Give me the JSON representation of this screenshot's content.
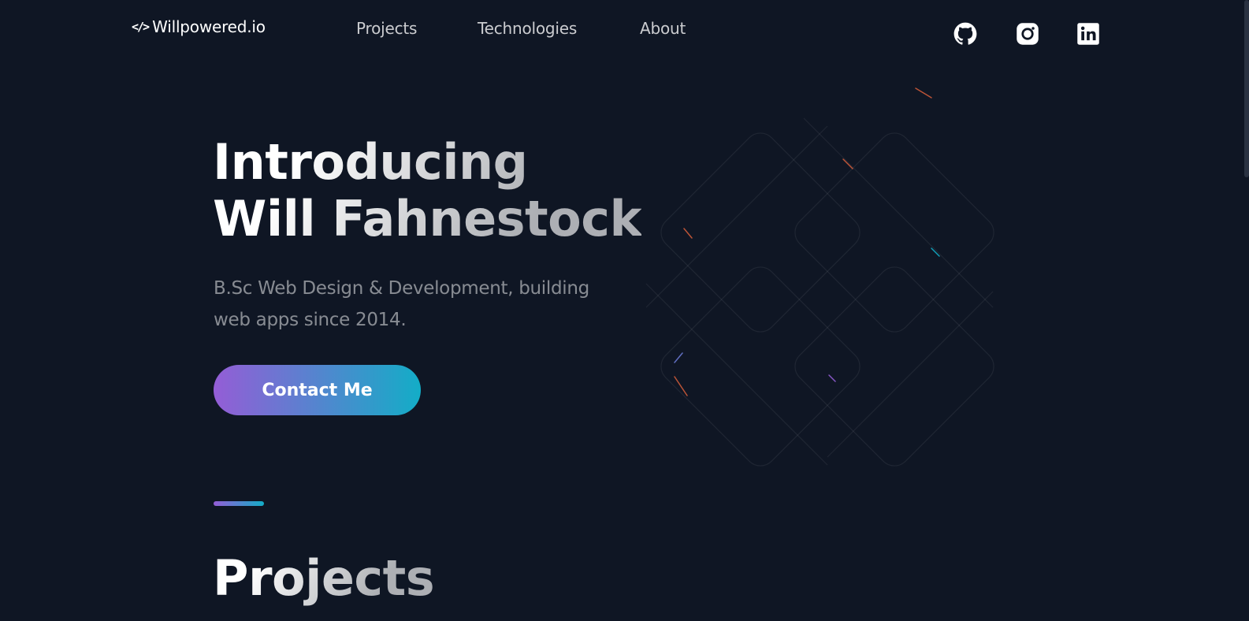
{
  "header": {
    "logo_icon": "</>",
    "logo_text": "Willpowered.io",
    "nav": [
      {
        "label": "Projects"
      },
      {
        "label": "Technologies"
      },
      {
        "label": "About"
      }
    ],
    "social_icons": [
      "github-icon",
      "instagram-icon",
      "linkedin-icon"
    ]
  },
  "hero": {
    "title_line1": "Introducing",
    "title_line2": "Will Fahnestock",
    "subtitle": "B.Sc Web Design & Development, building web apps since 2014.",
    "contact_label": "Contact Me"
  },
  "projects_section": {
    "title": "Projects"
  },
  "colors": {
    "background": "#0f1624",
    "gradient_start": "#945dd6",
    "gradient_mid": "#6978d1",
    "gradient_end": "#13adc7"
  }
}
